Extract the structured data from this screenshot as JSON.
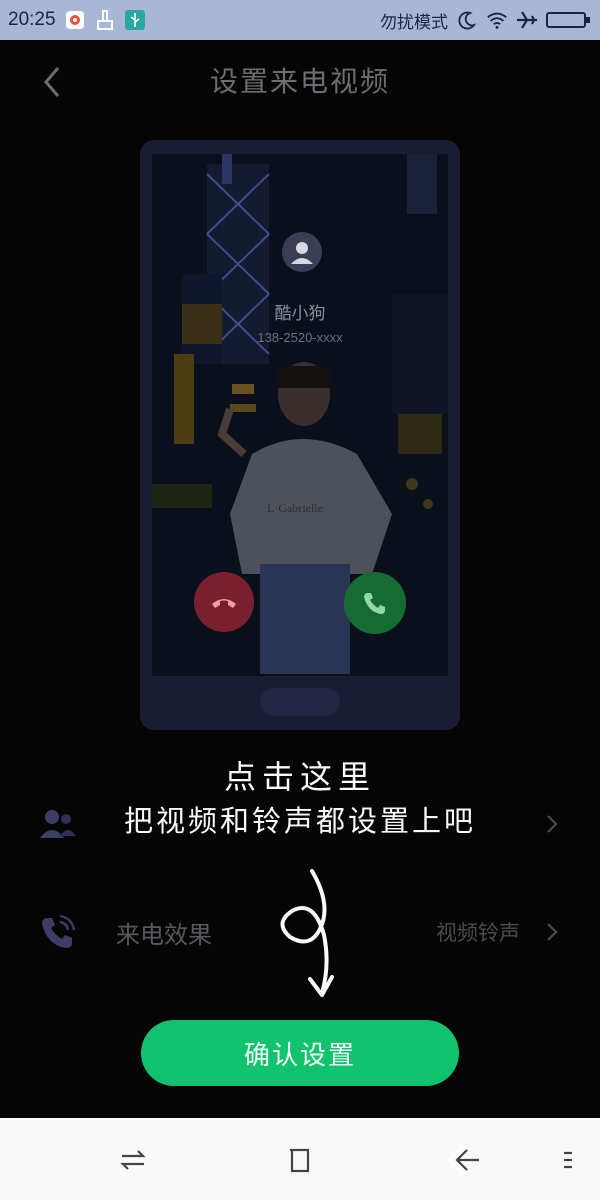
{
  "status_bar": {
    "time": "20:25",
    "dnd_text": "勿扰模式",
    "icons": [
      "app-icon",
      "cleaner-icon",
      "usb-icon",
      "moon-icon",
      "wifi-icon",
      "airplane-icon",
      "battery-icon"
    ]
  },
  "header": {
    "title": "设置来电视频",
    "back_icon": "back-arrow-icon"
  },
  "preview": {
    "caller_name": "酷小狗",
    "caller_number": "138-2520-xxxx",
    "decline_icon": "hang-up-icon",
    "accept_icon": "phone-icon"
  },
  "hint": {
    "line1": "点击这里",
    "line2": "把视频和铃声都设置上吧"
  },
  "rows": [
    {
      "icon": "contacts-icon",
      "label": "",
      "value": "",
      "chevron": "chevron-right-icon"
    },
    {
      "icon": "ringing-phone-icon",
      "label": "来电效果",
      "value": "视频铃声",
      "chevron": "chevron-right-icon"
    }
  ],
  "confirm_button": {
    "label": "确认设置"
  },
  "nav_bar": {
    "icons": [
      "switch-apps-icon",
      "home-square-icon",
      "back-icon",
      "menu-icon"
    ]
  },
  "colors": {
    "accent": "#12c26f",
    "status_bar": "#a9b6d6",
    "background": "#050506",
    "phone_frame": "#1a1c34"
  }
}
